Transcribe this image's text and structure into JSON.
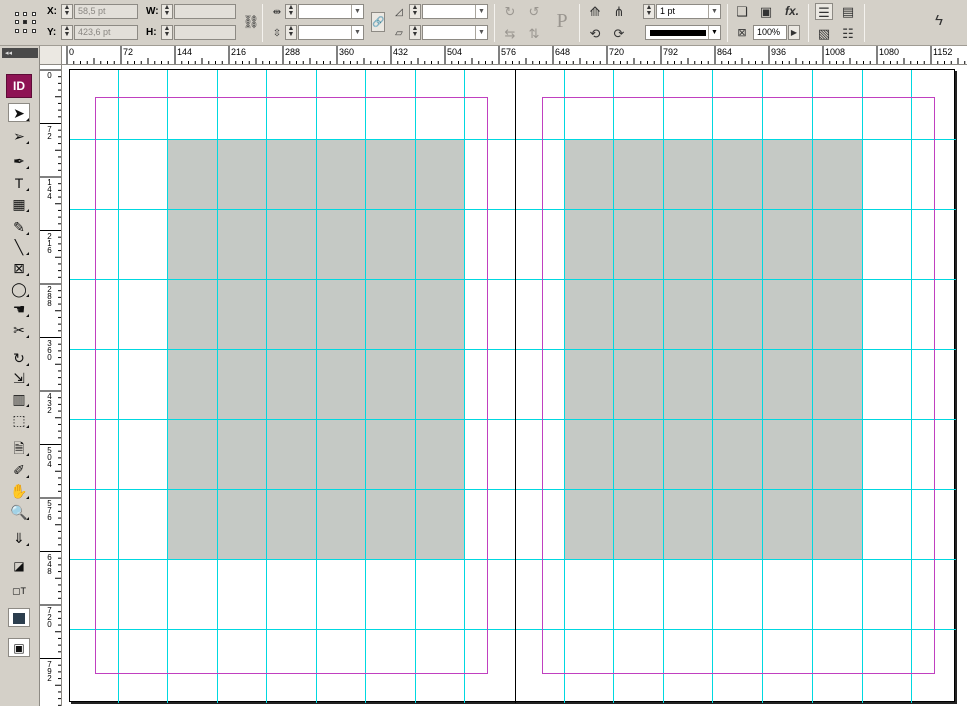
{
  "control_bar": {
    "x_label": "X:",
    "x_value": "58,5 pt",
    "y_label": "Y:",
    "y_value": "423,6 pt",
    "w_label": "W:",
    "w_value": "",
    "h_label": "H:",
    "h_value": "",
    "stroke_weight": "1 pt",
    "scale_value": "100%",
    "fx_label": "fx."
  },
  "toolbox": {
    "app_badge": "ID",
    "tools": [
      {
        "name": "selection-tool",
        "glyph": "➤"
      },
      {
        "name": "direct-selection-tool",
        "glyph": "➢"
      },
      {
        "name": "pen-tool",
        "glyph": "✒"
      },
      {
        "name": "type-tool",
        "glyph": "T"
      },
      {
        "name": "table-tool",
        "glyph": "▦"
      },
      {
        "name": "pencil-tool",
        "glyph": "✎"
      },
      {
        "name": "line-tool",
        "glyph": "╲"
      },
      {
        "name": "rectangle-frame-tool",
        "glyph": "⊠"
      },
      {
        "name": "ellipse-tool",
        "glyph": "◯"
      },
      {
        "name": "button-tool",
        "glyph": "☚"
      },
      {
        "name": "scissors-tool",
        "glyph": "✂"
      },
      {
        "name": "rotate-tool",
        "glyph": "↻"
      },
      {
        "name": "scale-tool",
        "glyph": "⇲"
      },
      {
        "name": "gradient-tool",
        "glyph": "▥"
      },
      {
        "name": "free-transform-tool",
        "glyph": "⬚"
      },
      {
        "name": "note-tool",
        "glyph": "🗎"
      },
      {
        "name": "eyedropper-tool",
        "glyph": "✐"
      },
      {
        "name": "hand-tool",
        "glyph": "✋"
      },
      {
        "name": "zoom-tool",
        "glyph": "🔍"
      },
      {
        "name": "collapse-tool",
        "glyph": "⇓"
      }
    ]
  },
  "rulers": {
    "horizontal": [
      "0",
      "72",
      "144",
      "216",
      "288",
      "360",
      "432",
      "504",
      "576",
      "648",
      "720",
      "792",
      "864",
      "936",
      "1008",
      "1080",
      "1152"
    ],
    "vertical": [
      "0",
      "72",
      "144",
      "216",
      "288",
      "360",
      "432",
      "504",
      "576",
      "648",
      "720",
      "792"
    ]
  },
  "colors": {
    "margin_guide": "#c040c0",
    "column_guide": "#00d8e0",
    "text_frame": "#c5c9c5",
    "app_badge": "#8e1354"
  }
}
